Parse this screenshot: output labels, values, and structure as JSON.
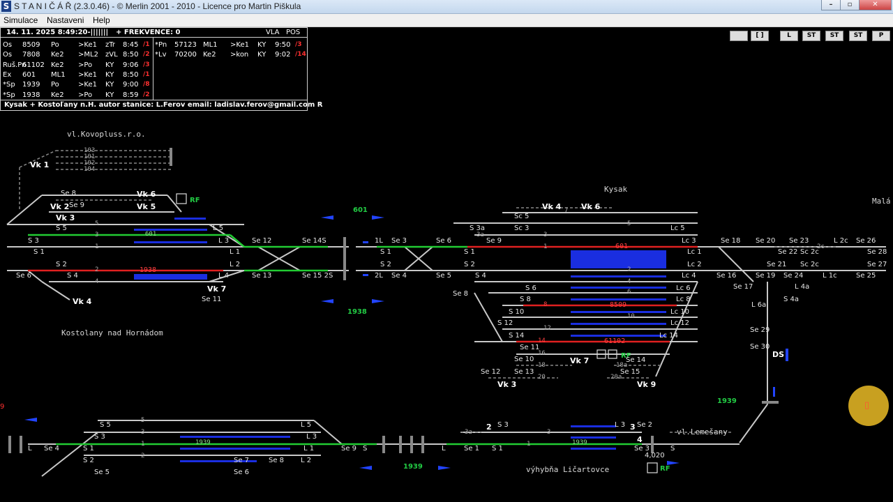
{
  "window": {
    "icon": "S",
    "title": "S T A N I Č Á Ř (2.3.0.46) - © Merlin 2001 - 2010 - Licence pro Martin Piškula",
    "min_icon": "minimize-icon",
    "max_icon": "maximize-icon",
    "close_icon": "close-icon"
  },
  "menu": [
    "Simulace",
    "Nastaveni",
    "Help"
  ],
  "status": {
    "datetime": "14. 11. 2025 8:49:20-|||||||",
    "frekvence": "+ FREKVENCE: 0",
    "vla": "VLA",
    "pos": "POS",
    "footer": "Kysak + Kostoľany n.H. autor stanice: L.Ferov email: ladislav.ferov@gmail.com R"
  },
  "trains_left": [
    {
      "type": "Os",
      "num": "8509",
      "from": "Po",
      "to": ">Ke1",
      "track": "zTr",
      "time": "8:45",
      "delay": "/1"
    },
    {
      "type": "Os",
      "num": "7808",
      "from": "Ke2",
      "to": ">ML2",
      "track": "zVL",
      "time": "8:50",
      "delay": "/2"
    },
    {
      "type": "Ruš.Pn",
      "num": "61102",
      "from": "Ke2",
      "to": ">Po",
      "track": "KY",
      "time": "9:06",
      "delay": "/3"
    },
    {
      "type": "Ex",
      "num": "601",
      "from": "ML1",
      "to": ">Ke1",
      "track": "KY",
      "time": "8:50",
      "delay": "/1"
    },
    {
      "type": "*Sp",
      "num": "1939",
      "from": "Po",
      "to": ">Ke1",
      "track": "KY",
      "time": "9:00",
      "delay": "/8"
    },
    {
      "type": "*Sp",
      "num": "1938",
      "from": "Ke2",
      "to": ">Po",
      "track": "KY",
      "time": "8:59",
      "delay": "/2"
    }
  ],
  "trains_right": [
    {
      "type": "*Pn",
      "num": "57123",
      "from": "ML1",
      "to": ">Ke1",
      "track": "KY",
      "time": "9:50",
      "delay": "/3"
    },
    {
      "type": "*Lv",
      "num": "70200",
      "from": "Ke2",
      "to": ">kon",
      "track": "KY",
      "time": "9:02",
      "delay": "/14"
    }
  ],
  "toolbar": [
    "",
    "[ ]",
    "L",
    "ST",
    "ST",
    "ST",
    "P"
  ],
  "stations": {
    "kostolany": "Kostolany nad Hornádom",
    "kovopluss": "vl.Kovopluss.r.o.",
    "kysak": "Kysak",
    "mala": "Malá",
    "licartovce": "výhybňa Ličartovce",
    "lemesany": "vl.Lemešany"
  },
  "train_labels": {
    "t601_top": "601",
    "t601_kostolany": "601",
    "t601_kysak": "601",
    "t1938_kostolany": "1938",
    "t1938_between": "1938",
    "t8509": "8509",
    "t61102": "61102",
    "t1939_right": "1939",
    "t1939_bottom": "1939",
    "t1939_licartovce": "1939",
    "t1939_between": "1939",
    "km": "4,020",
    "num9": "9"
  },
  "rf": "RF",
  "signals_k": {
    "vk1": "Vk 1",
    "se8": "Se 8",
    "vk6": "Vk 6",
    "vk2": "Vk 2",
    "se9": "Se 9",
    "vk5": "Vk 5",
    "vk3": "Vk 3",
    "s5": "S 5",
    "l5": "L 5",
    "s3": "S 3",
    "l3": "L 3",
    "s1": "S 1",
    "l1": "L 1",
    "s2": "S 2",
    "l2": "L 2",
    "se6": "Se 6",
    "s4": "S 4",
    "l4": "L 4",
    "vk7": "Vk 7",
    "vk4": "Vk 4",
    "se11": "Se 11",
    "se12": "Se 12",
    "se13": "Se 13",
    "se14s": "Se 14S",
    "se15s": "Se 15 2S"
  },
  "signals_ky": {
    "l1": "1L",
    "l2": "2L",
    "s1": "S 1",
    "s2": "S 2",
    "se3": "Se 3",
    "se4": "Se 4",
    "se5": "Se 5",
    "se6": "Se 6",
    "ks1": "S 1",
    "ks2": "S 2",
    "s3a": "S 3a",
    "se9": "Se 9",
    "sc3": "Sc 3",
    "sc5": "Sc 5",
    "vk4": "Vk 4",
    "vk6": "Vk 6",
    "ks4": "S 4",
    "se8": "Se 8",
    "s6": "S 6",
    "s8": "S 8",
    "s10": "S 10",
    "s12": "S 12",
    "s14": "S 14",
    "se11": "Se 11",
    "se10": "Se 10",
    "se12": "Se 12",
    "se13": "Se 13",
    "vk3": "Vk 3",
    "vk7": "Vk 7",
    "se14": "Se 14",
    "se15": "Se 15",
    "vk9": "Vk 9",
    "lc5": "Lc 5",
    "lc3": "Lc 3",
    "lc1": "Lc 1",
    "lc2": "Lc 2",
    "lc4": "Lc 4",
    "lc6": "Lc 6",
    "lc8": "Lc 8",
    "lc10": "Lc 10",
    "lc12": "Lc 12",
    "lc14": "Lc 14",
    "se18": "Se 18",
    "se20": "Se 20",
    "se23": "Se 23",
    "l2c": "L 2c",
    "se26": "Se 26",
    "se28": "Se 28",
    "se22": "Se 22",
    "sc2c": "Sc 2c",
    "se21": "Se 21",
    "sc2c2": "Sc 2c",
    "se27": "Se 27",
    "se16": "Se 16",
    "se19": "Se 19",
    "se24": "Se 24",
    "l1c": "L 1c",
    "se25": "Se 25",
    "se17": "Se 17",
    "l4a": "L 4a",
    "l6a": "L 6a",
    "s4a": "S 4a",
    "se29": "Se 29",
    "se30": "Se 30",
    "ds": "DS"
  },
  "signals_bottom": {
    "l": "L",
    "se4": "Se 4",
    "s5": "S 5",
    "s3": "S 3",
    "s1": "S 1",
    "s2": "S 2",
    "se5": "Se 5",
    "l5": "L 5",
    "l3": "L 3",
    "l1": "L 1",
    "l2": "L 2",
    "se7": "Se 7",
    "se8": "Se 8",
    "se6": "Se 6",
    "se9": "Se 9",
    "s": "S",
    "l_b": "L",
    "se1": "Se 1",
    "s1b": "S 1",
    "s3b": "S 3",
    "n2": "2",
    "l3b": "L 3",
    "n3": "3",
    "se2": "Se 2",
    "n4": "4",
    "se3": "Se 3",
    "s_b": "S"
  },
  "tracks": {
    "t1": "1",
    "t2": "2",
    "t3": "3",
    "t4": "4",
    "t5": "5",
    "t6": "6",
    "t7": "7",
    "t8": "8",
    "t10": "10",
    "t12": "12",
    "t14": "14",
    "t16": "16",
    "t18": "18",
    "t18a": "18a",
    "t20": "20",
    "t20a": "20a",
    "t3a": "3a",
    "t2c": "2c",
    "t103": "103",
    "t101": "101",
    "t102": "102",
    "t104": "104"
  },
  "colors": {
    "route_green": "#22cc33",
    "route_red": "#e02020",
    "occupied_blue": "#1a2ee0",
    "track_gray": "#c8c8c8",
    "arrow_blue": "#2244ff",
    "clock_gold": "#c8a020"
  },
  "misc": {
    "clock_icon": "clock-icon",
    "clock_text": "▯"
  }
}
